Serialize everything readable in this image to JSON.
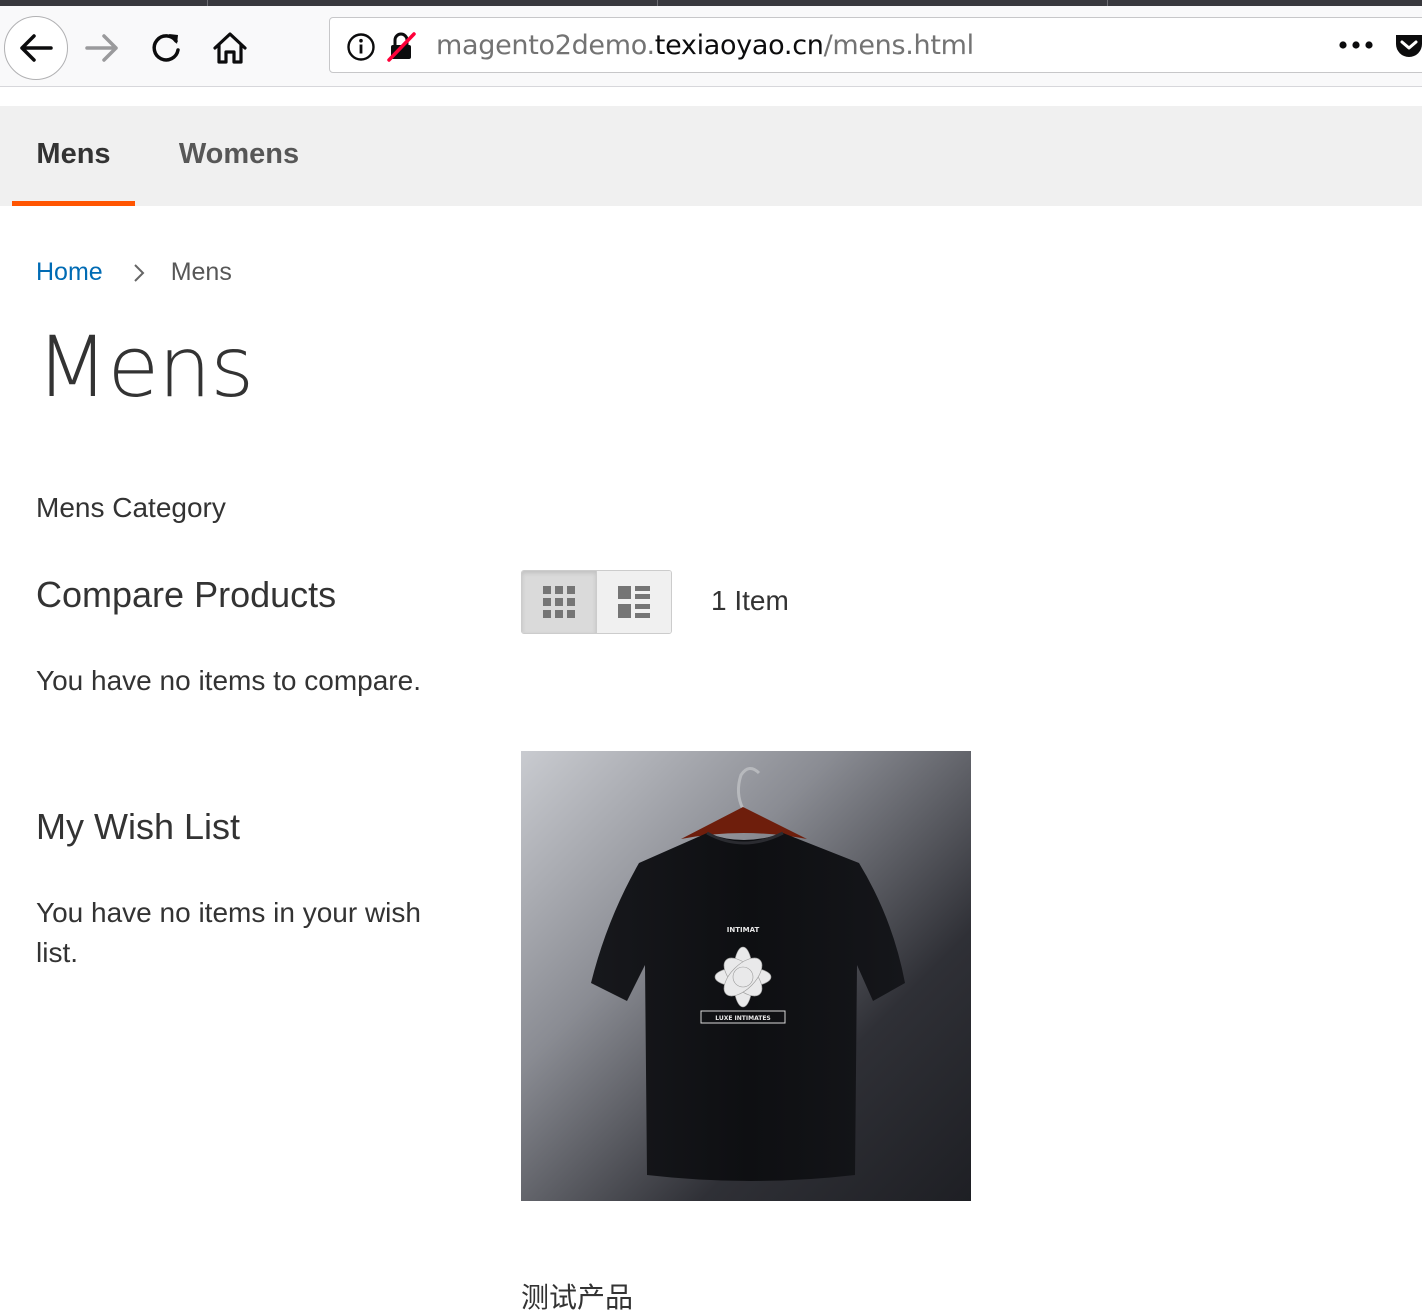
{
  "browser": {
    "url_prefix": "magento2demo.",
    "url_host": "texiaoyao.cn",
    "url_path": "/mens.html"
  },
  "nav": {
    "items": [
      {
        "label": "Mens",
        "active": true
      },
      {
        "label": "Womens",
        "active": false
      }
    ],
    "active_color": "#ff5501"
  },
  "breadcrumb": {
    "home": "Home",
    "current": "Mens"
  },
  "page": {
    "title": "Mens",
    "category_description": "Mens Category"
  },
  "sidebar": {
    "compare": {
      "title": "Compare Products",
      "empty_text": "You have no items to compare."
    },
    "wishlist": {
      "title": "My Wish List",
      "empty_text": "You have no items in your wish list."
    }
  },
  "toolbar": {
    "modes": [
      {
        "name": "Grid",
        "icon": "grid-icon",
        "active": true
      },
      {
        "name": "List",
        "icon": "list-icon",
        "active": false
      }
    ],
    "amount": "1 Item"
  },
  "products": [
    {
      "name": "测试产品",
      "image": "black t-shirt on hanger",
      "print_top": "INTIMAT",
      "print_bottom": "LUXE INTIMATES"
    }
  ],
  "link_color": "#006bb4"
}
